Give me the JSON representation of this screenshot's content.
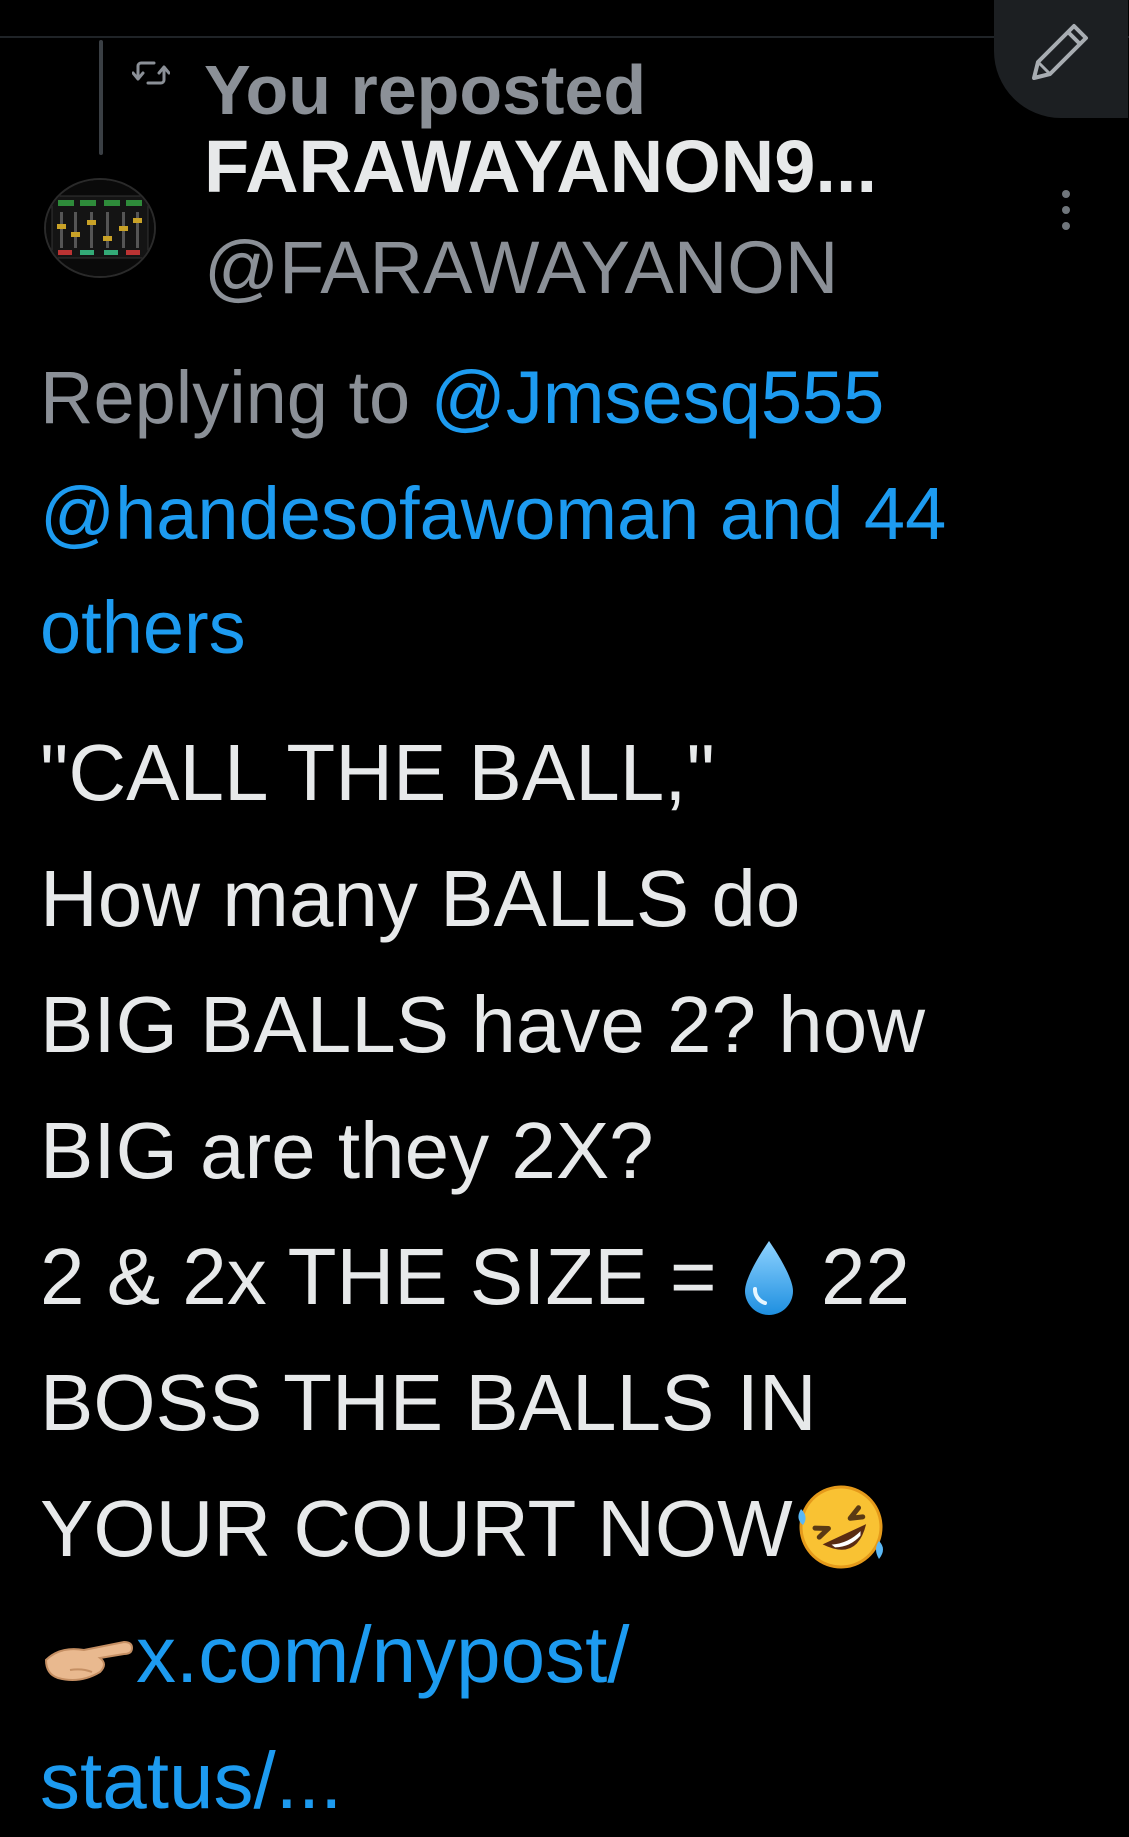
{
  "header": {
    "repost_label": "You reposted"
  },
  "post": {
    "author": {
      "display_name": "FARAWAYANON9...",
      "handle": "@FARAWAYANON"
    },
    "reply_to": {
      "prefix": "Replying to",
      "mention_1": "@Jmsesq555",
      "mention_2": "@handesofawoman",
      "suffix_and": "and 44",
      "suffix_others": "others"
    },
    "body": {
      "line_1": "\"CALL THE BALL,\"",
      "line_2": "How many BALLS do",
      "line_3": "BIG BALLS have 2? how",
      "line_4": "BIG are they 2X?",
      "line_5_before_emoji": "2 & 2x THE SIZE = ",
      "line_5_after_emoji": " 22",
      "line_6": "BOSS THE BALLS IN",
      "line_7": "YOUR COURT NOW",
      "link_line_1": "x.com/nypost/",
      "link_line_2": "status/..."
    }
  },
  "icons": {
    "repost": "repost-icon",
    "compose": "compose-pencil-icon",
    "more": "more-vertical-icon",
    "droplet": "droplet-emoji",
    "laughing": "rolling-on-floor-laughing-emoji",
    "pointing_hand": "pointing-hand-emoji"
  },
  "colors": {
    "background": "#000000",
    "text": "#e7e9ea",
    "muted": "#8b9097",
    "link": "#1d9bf0"
  }
}
